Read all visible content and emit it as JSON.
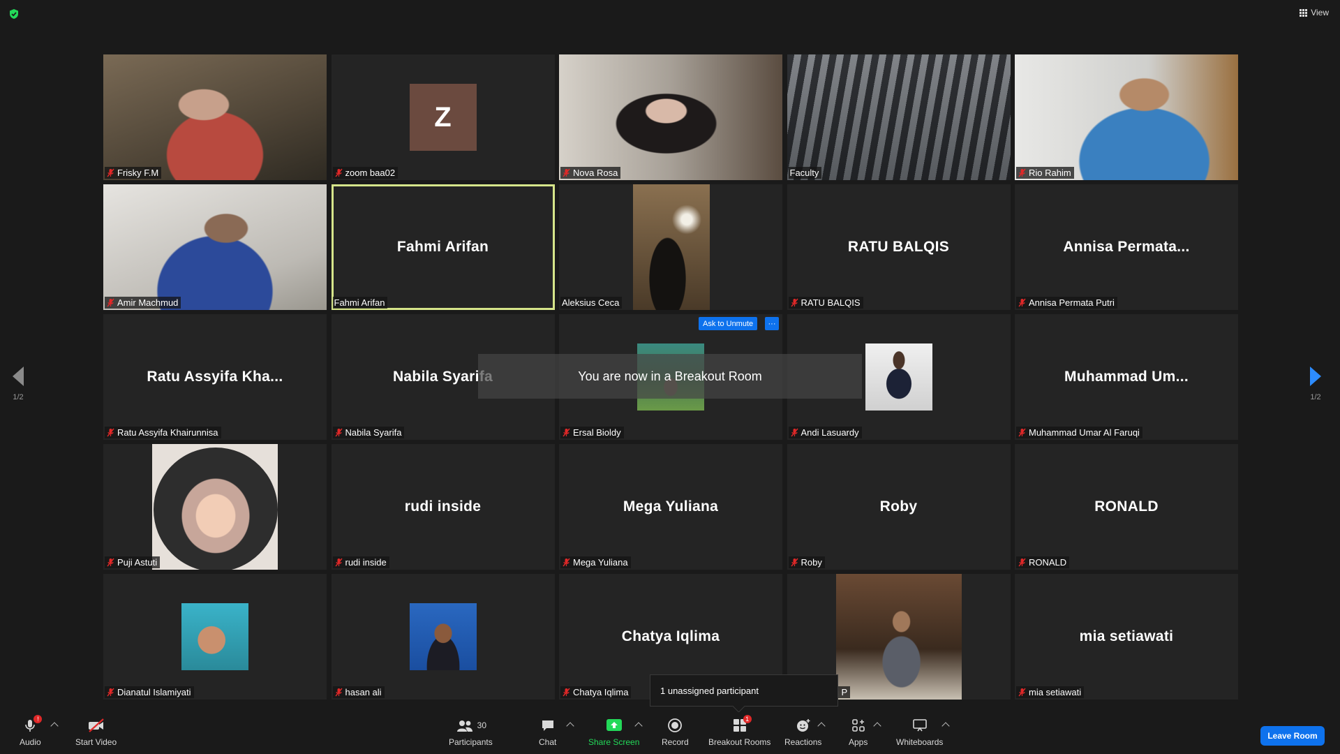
{
  "header": {
    "view_label": "View"
  },
  "pager": {
    "left_label": "1/2",
    "right_label": "1/2"
  },
  "tiles": [
    {
      "name": "Frisky F.M"
    },
    {
      "name": "zoom baa02",
      "avatar_letter": "Z"
    },
    {
      "name": "Nova Rosa"
    },
    {
      "name": "Faculty"
    },
    {
      "name": "Rio Rahim"
    },
    {
      "name": "Amir Machmud"
    },
    {
      "name": "Fahmi Arifan",
      "display": "Fahmi Arifan"
    },
    {
      "name": "Aleksius Ceca"
    },
    {
      "name": "RATU BALQIS",
      "display": "RATU BALQIS"
    },
    {
      "name": "Annisa Permata Putri",
      "display": "Annisa  Permata..."
    },
    {
      "name": "Ratu Assyifa Khairunnisa",
      "display": "Ratu  Assyifa  Kha..."
    },
    {
      "name": "Nabila Syarifa",
      "display": "Nabila Syarifa"
    },
    {
      "name": "Ersal Bioldy"
    },
    {
      "name": "Andi Lasuardy"
    },
    {
      "name": "Muhammad Umar Al Faruqi",
      "display": "Muhammad  Um..."
    },
    {
      "name": "Puji Astuti"
    },
    {
      "name": "rudi inside",
      "display": "rudi inside"
    },
    {
      "name": "Mega Yuliana",
      "display": "Mega Yuliana"
    },
    {
      "name": "Roby",
      "display": "Roby"
    },
    {
      "name": "RONALD",
      "display": "RONALD"
    },
    {
      "name": "Dianatul Islamiyati"
    },
    {
      "name": "hasan ali"
    },
    {
      "name": "Chatya Iqlima",
      "display": "Chatya Iqlima"
    },
    {
      "name": "rdi P"
    },
    {
      "name": "mia setiawati",
      "display": "mia setiawati"
    }
  ],
  "breakout_banner": "You are now in a Breakout Room",
  "ask_to_unmute": "Ask to Unmute",
  "more_label": "···",
  "tooltip": "1 unassigned participant",
  "toolbar": {
    "audio_label": "Audio",
    "audio_badge": "!",
    "video_label": "Start Video",
    "participants_label": "Participants",
    "participants_count": "30",
    "chat_label": "Chat",
    "share_label": "Share Screen",
    "record_label": "Record",
    "breakout_label": "Breakout Rooms",
    "breakout_badge": "1",
    "reactions_label": "Reactions",
    "apps_label": "Apps",
    "whiteboards_label": "Whiteboards",
    "leave_label": "Leave Room"
  },
  "colors": {
    "accent_blue": "#0e72ed",
    "share_green": "#23d959",
    "active_outline": "#d6e58a",
    "muted_red": "#e02828"
  }
}
